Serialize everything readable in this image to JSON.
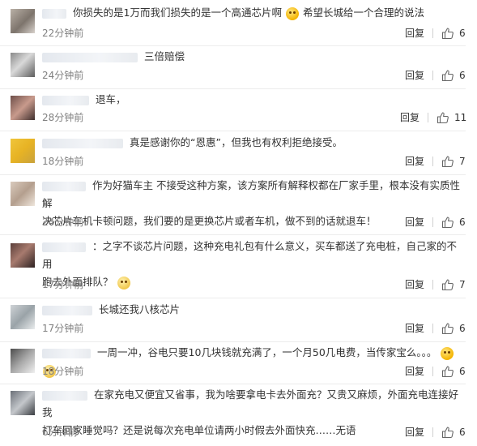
{
  "labels": {
    "reply": "回复"
  },
  "comments": [
    {
      "text": "你损失的是1万而我们损失的是一个高通芯片啊",
      "text2": "希望长城给一个合理的说法",
      "time": "22分钟前",
      "likes": "6"
    },
    {
      "text": "三倍赔偿",
      "time": "24分钟前",
      "likes": "6"
    },
    {
      "text": "退车，",
      "time": "28分钟前",
      "likes": "11"
    },
    {
      "text": "真是感谢你的“恩惠”，但我也有权利拒绝接受。",
      "time": "18分钟前",
      "likes": "7"
    },
    {
      "text": "作为好猫车主 不接受这种方案，该方案所有解释权都在厂家手里，根本没有实质性解",
      "text2": "决芯片车机卡顿问题，我们要的是更换芯片或者车机，做不到的话就退车！",
      "time": "24分钟前",
      "likes": "6"
    },
    {
      "text": "：之字不谈芯片问题，这种充电礼包有什么意义，买车都送了充电桩，自己家的不用",
      "text2": "跑去外面排队？",
      "time": "17分钟前",
      "likes": "7"
    },
    {
      "text": "长城还我八核芯片",
      "time": "17分钟前",
      "likes": "6"
    },
    {
      "text": "一周一冲，谷电只要10几块钱就充满了，一个月50几电费，当传家宝么。。。",
      "time": "18分钟前",
      "likes": "6"
    },
    {
      "text": "在家充电又便宜又省事，我为啥要拿电卡去外面充？又贵又麻烦，外面充电连接好我",
      "text2": "打车回家睡觉吗？还是说每次充电单位请两小时假去外面快充……无语",
      "time": "6分钟前",
      "likes": "6"
    }
  ]
}
